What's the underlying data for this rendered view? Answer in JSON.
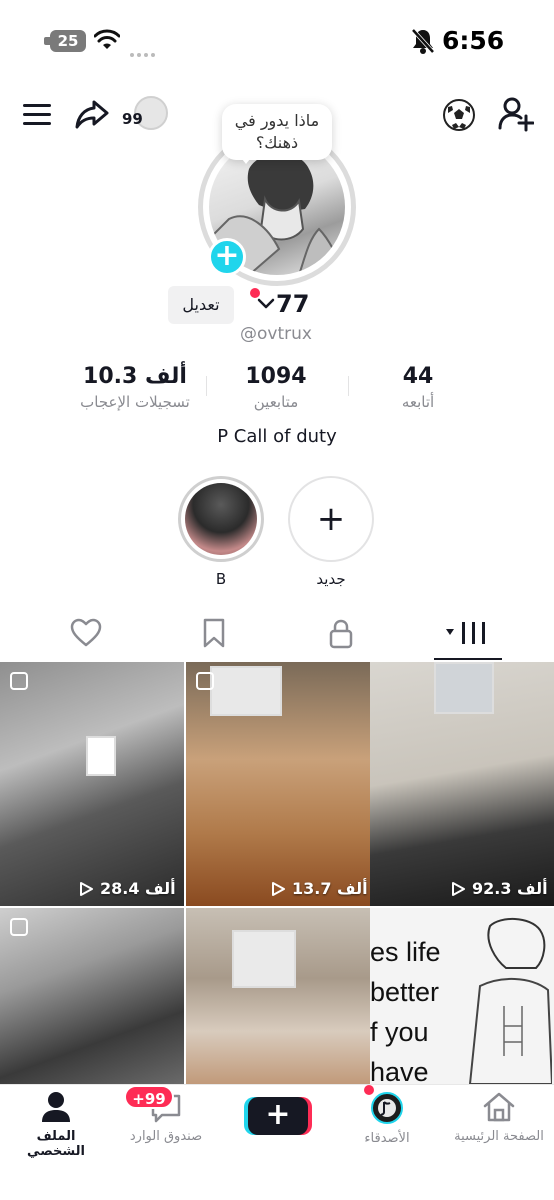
{
  "status_bar": {
    "battery": "25",
    "time": "6:56"
  },
  "top_bar": {
    "coins": "99"
  },
  "profile": {
    "bubble_text": "ماذا يدور في ذهنك؟",
    "edit_label": "تعديل",
    "username": "77",
    "handle": "@ovtrux"
  },
  "stats": {
    "likes_value": "10.3 ألف",
    "likes_label": "تسجيلات الإعجاب",
    "followers_value": "1094",
    "followers_label": "متابعين",
    "following_value": "44",
    "following_label": "أتابعه"
  },
  "bio": "P Call of duty",
  "highlights": [
    {
      "label": "B"
    },
    {
      "label": "جديد"
    }
  ],
  "videos": [
    {
      "views": "28.4 ألف"
    },
    {
      "views": "13.7 ألف"
    },
    {
      "views": "92.3 ألف"
    },
    {
      "views": ""
    },
    {
      "views": ""
    },
    {
      "views": "",
      "text_lines": [
        "es life",
        "better",
        "f you",
        "have"
      ]
    }
  ],
  "bottom_nav": {
    "profile": "الملف الشخصي",
    "inbox": "صندوق الوارد",
    "inbox_badge": "+99",
    "create": "+",
    "friends": "الأصدقاء",
    "home": "الصفحة الرئيسية"
  },
  "colors": {
    "accent_red": "#fe2c55",
    "accent_cyan": "#20d5ec",
    "text_primary": "#161823",
    "text_secondary": "#8a8b91"
  }
}
